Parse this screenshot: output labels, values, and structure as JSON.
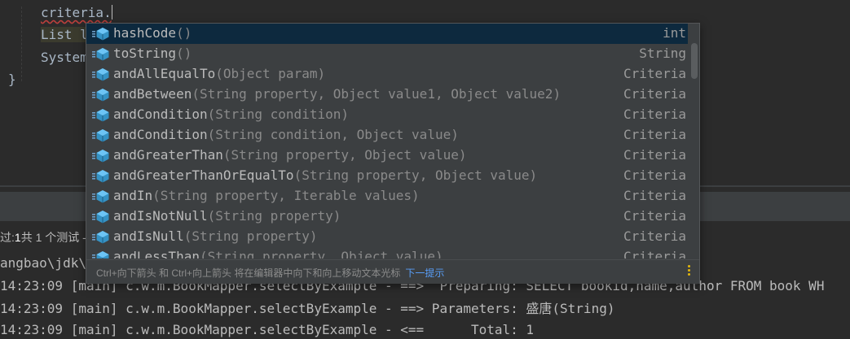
{
  "editor": {
    "line1": "criteria.",
    "line2_prefix": "List l",
    "line3_prefix": "System",
    "line4": "}"
  },
  "completion": {
    "items": [
      {
        "name": "hashCode",
        "params": "()",
        "ret": "int"
      },
      {
        "name": "toString",
        "params": "()",
        "ret": "String"
      },
      {
        "name": "andAllEqualTo",
        "params": "(Object param)",
        "ret": "Criteria"
      },
      {
        "name": "andBetween",
        "params": "(String property, Object value1, Object value2)",
        "ret": "Criteria"
      },
      {
        "name": "andCondition",
        "params": "(String condition)",
        "ret": "Criteria"
      },
      {
        "name": "andCondition",
        "params": "(String condition, Object value)",
        "ret": "Criteria"
      },
      {
        "name": "andGreaterThan",
        "params": "(String property, Object value)",
        "ret": "Criteria"
      },
      {
        "name": "andGreaterThanOrEqualTo",
        "params": "(String property, Object value)",
        "ret": "Criteria"
      },
      {
        "name": "andIn",
        "params": "(String property, Iterable values)",
        "ret": "Criteria"
      },
      {
        "name": "andIsNotNull",
        "params": "(String property)",
        "ret": "Criteria"
      },
      {
        "name": "andIsNull",
        "params": "(String property)",
        "ret": "Criteria"
      },
      {
        "name": "andLessThan",
        "params": "(String property, Object value)",
        "ret": "Criteria"
      }
    ],
    "footer_hint": "Ctrl+向下箭头 和 Ctrl+向上箭头 将在编辑器中向下和向上移动文本光标",
    "footer_next": "下一提示"
  },
  "run": {
    "status_prefix": "过:",
    "status_count": "1",
    "status_text": "共 1 个测试 - ",
    "path": "angbao\\jdk\\",
    "logs": [
      "14:23:09 [main] c.w.m.BookMapper.selectByExample - ==>  Preparing: SELECT bookid,name,author FROM book WH",
      "14:23:09 [main] c.w.m.BookMapper.selectByExample - ==> Parameters: 盛唐(String)",
      "14:23:09 [main] c.w.m.BookMapper.selectByExample - <==      Total: 1"
    ]
  },
  "colors": {
    "method_icon": "#3592c4",
    "lock_icon": "#6e9ec7",
    "selected_bg": "#0d293e",
    "link": "#589df6",
    "accent": "#e5b80b"
  }
}
